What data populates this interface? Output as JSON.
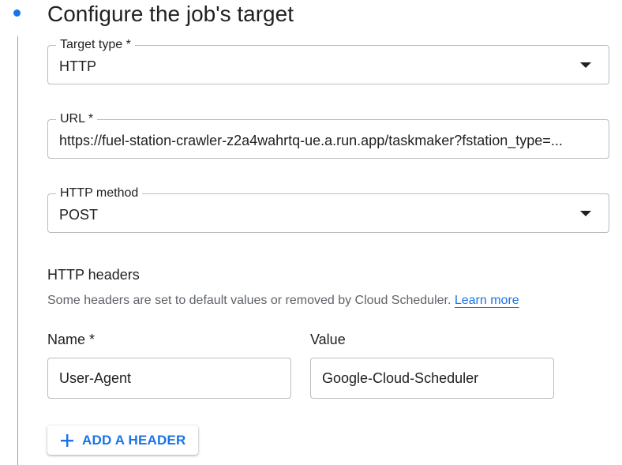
{
  "step": {
    "title": "Configure the job's target"
  },
  "target_type": {
    "label": "Target type *",
    "value": "HTTP"
  },
  "url": {
    "label": "URL *",
    "value": "https://fuel-station-crawler-z2a4wahrtq-ue.a.run.app/taskmaker?fstation_type=..."
  },
  "http_method": {
    "label": "HTTP method",
    "value": "POST"
  },
  "headers": {
    "heading": "HTTP headers",
    "helper": "Some headers are set to default values or removed by Cloud Scheduler.",
    "learn_more": "Learn more",
    "name_label": "Name *",
    "value_label": "Value",
    "rows": [
      {
        "name": "User-Agent",
        "value": "Google-Cloud-Scheduler"
      }
    ],
    "add_label": "ADD A HEADER"
  },
  "colors": {
    "accent": "#1a73e8",
    "text": "#202124",
    "secondary_text": "#5f6368",
    "border": "#b9bcc0"
  },
  "icons": {
    "step": "step-dot-icon",
    "dropdown": "dropdown-arrow-icon",
    "add": "plus-icon"
  }
}
